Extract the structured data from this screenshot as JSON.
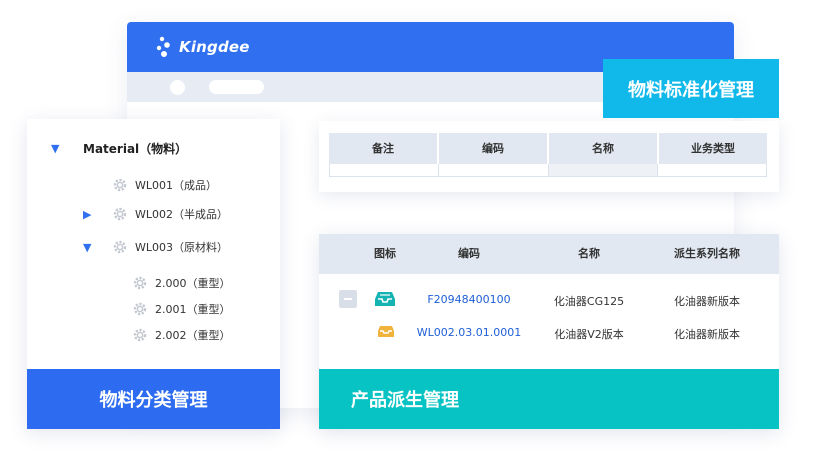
{
  "app": {
    "brand": "Kingdee"
  },
  "standardization": {
    "title": "物料标准化管理",
    "columns": [
      "备注",
      "编码",
      "名称",
      "业务类型"
    ]
  },
  "category": {
    "title": "物料分类管理",
    "tree": {
      "root": "Material（物料）",
      "items": [
        {
          "label": "WL001（成品）"
        },
        {
          "label": "WL002（半成品）"
        },
        {
          "label": "WL003（原材料）",
          "children": [
            {
              "label": "2.000（重型）"
            },
            {
              "label": "2.001（重型）"
            },
            {
              "label": "2.002（重型）"
            }
          ]
        }
      ]
    }
  },
  "derivation": {
    "title": "产品派生管理",
    "columns": [
      "图标",
      "编码",
      "名称",
      "派生系列名称"
    ],
    "rows": [
      {
        "code": "F20948400100",
        "name": "化油器CG125",
        "series": "化油器新版本",
        "icon": "tray-teal-icon"
      },
      {
        "code": "WL002.03.01.0001",
        "name": "化油器V2版本",
        "series": "化油器新版本",
        "icon": "tray-yellow-icon"
      }
    ]
  },
  "colors": {
    "brand_blue": "#2f6ff0",
    "std_badge": "#10b9ea",
    "derivation_teal": "#08c3c3",
    "link_blue": "#1f5fd6"
  }
}
